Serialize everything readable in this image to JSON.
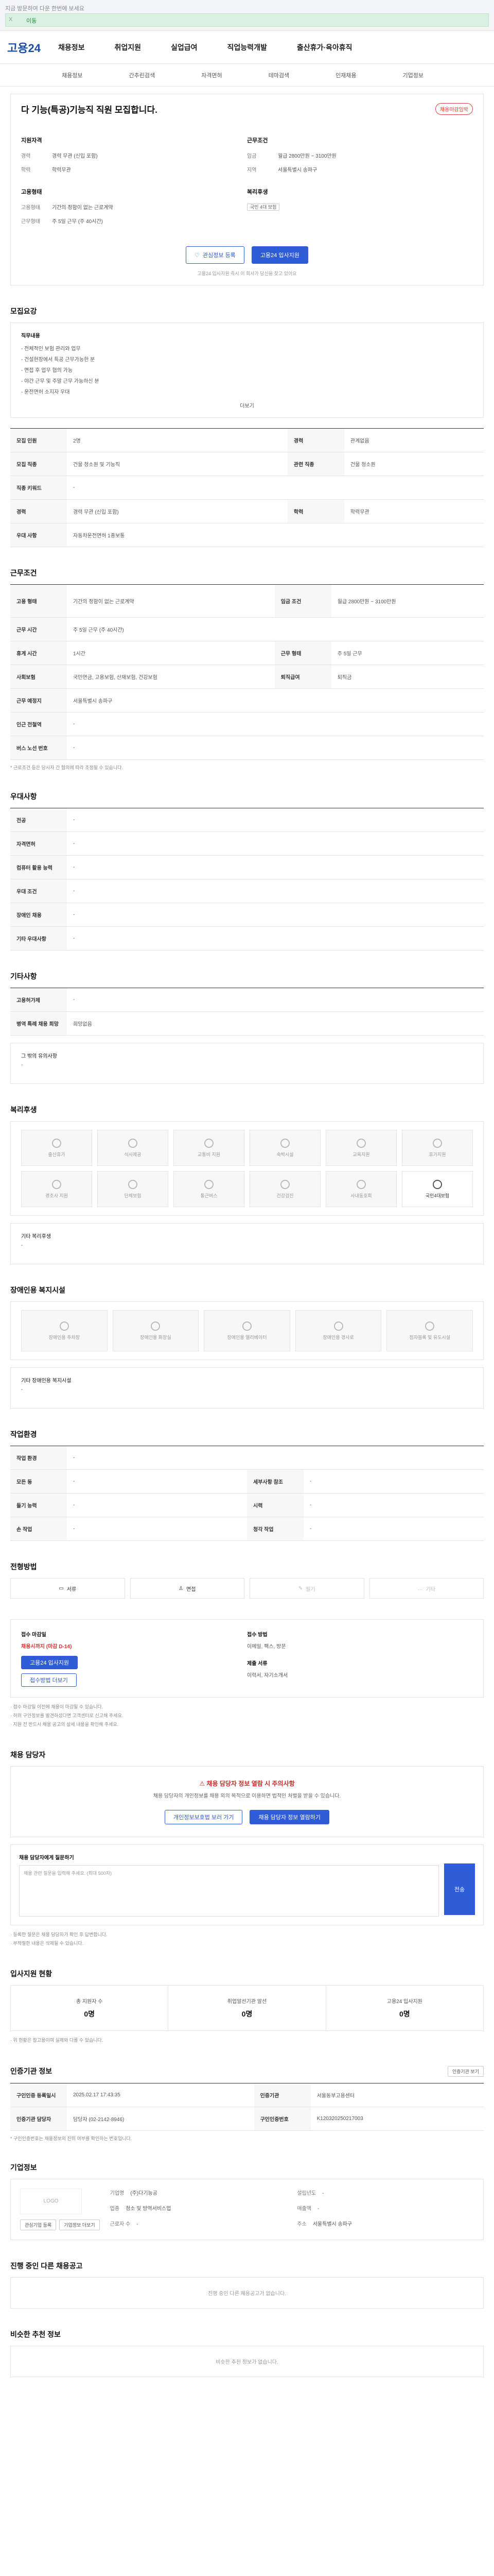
{
  "topbar": {
    "ad_text": "지금 방문하여 다운 한번에 보세요",
    "close": "X",
    "go": "이동"
  },
  "gnb": {
    "logo": "고용24",
    "items": [
      "채용정보",
      "취업지원",
      "실업급여",
      "직업능력개발",
      "출산휴가·육아휴직"
    ]
  },
  "subnav": [
    "채용정보",
    "간추린검색",
    "자격면허",
    "테마검색",
    "인재채용",
    "기업정보"
  ],
  "title": {
    "text": "다 기능(특공)기능직 직원 모집합니다.",
    "badge": "채용마감임박"
  },
  "summary": {
    "left_label": "지원자격",
    "left": [
      {
        "k": "경력",
        "v": "경력 무관 (신입 포함)"
      },
      {
        "k": "학력",
        "v": "학력무관"
      }
    ],
    "left_label2": "고용형태",
    "left2": [
      {
        "k": "고용형태",
        "v": "기간의 정함이 없는 근로계약"
      },
      {
        "k": "근무형태",
        "v": "주 5일 근무 (주 40시간)"
      }
    ],
    "right_label": "근무조건",
    "right": [
      {
        "k": "임금",
        "v": "월급 2800만원 ~ 3100만원"
      },
      {
        "k": "지역",
        "v": "서울특별시 송파구"
      }
    ],
    "right_label2": "복리후생",
    "right_tag": "국민 4대 보험"
  },
  "buttons": {
    "scrap": "관심정보 등록",
    "apply": "고용24 입사지원"
  },
  "note": "고용24 입사지원 즉시 이 회사가 당신을 찾고 있어요",
  "recruit": {
    "title": "모집요강",
    "subtitle": "직무내용",
    "lines": [
      "- 전체적인 보험 관리와 업무",
      "- 건설현장에서 특공 근무가능한 분",
      "- 면접 후 업무 협의 가능",
      "- 야간 근무 및 주말 근무 가능하신 분",
      "- 운전면허 소지자 우대"
    ],
    "more": "더보기"
  },
  "info_rows": [
    {
      "k1": "모집 인원",
      "v1": "2명",
      "k2": "경력",
      "v2": "관계없음"
    },
    {
      "k1": "모집 직종",
      "v1": "건물 청소원 및 기능직",
      "k2": "관련 직종",
      "v2": "건물 청소원"
    },
    {
      "k1": "직종 키워드",
      "v1": "-",
      "k2": "",
      "v2": ""
    },
    {
      "k1": "경력",
      "v1": "경력 무관 (신입 포함)",
      "k2": "학력",
      "v2": "학력무관"
    },
    {
      "k1": "우대 사항",
      "v1": "자동차운전면허 1종보통",
      "k2": "",
      "v2": ""
    }
  ],
  "workcond": {
    "title": "근무조건",
    "rows": [
      {
        "k1": "고용 형태",
        "v1": "기간의 정함이 없는 근로계약",
        "k2": "임금 조건",
        "v2": "월급 2800만원 ~ 3100만원"
      },
      {
        "k1": "근무 시간",
        "v1": "주 5일 근무 (주 40시간)",
        "k2": "",
        "v2": ""
      },
      {
        "k1": "휴게 시간",
        "v1": "1시간",
        "k2": "근무 형태",
        "v2": "주 5일 근무"
      },
      {
        "k1": "사회보험",
        "v1": "국민연금, 고용보험, 산재보험, 건강보험",
        "k2": "퇴직급여",
        "v2": "퇴직금"
      },
      {
        "k1": "근무 예정지",
        "v1": "서울특별시 송파구",
        "k2": "",
        "v2": ""
      },
      {
        "k1": "인근 전철역",
        "v1": "-",
        "k2": "",
        "v2": ""
      },
      {
        "k1": "버스 노선 번호",
        "v1": "-",
        "k2": "",
        "v2": ""
      }
    ],
    "note": "* 근로조건 등은 당사자 간 협의에 따라 조정될 수 있습니다."
  },
  "etc": {
    "title": "우대사항",
    "rows": [
      {
        "k": "전공",
        "v": "-"
      },
      {
        "k": "자격면허",
        "v": "-"
      },
      {
        "k": "컴퓨터 활용 능력",
        "v": "-"
      },
      {
        "k": "우대 조건",
        "v": "-"
      },
      {
        "k": "장애인 채용",
        "v": "-"
      },
      {
        "k": "기타 우대사항",
        "v": "-"
      }
    ]
  },
  "other": {
    "title": "기타사항",
    "rows": [
      {
        "k": "고용허가제",
        "v": "-"
      },
      {
        "k": "병역 특례 채용 희망",
        "v": "희망없음"
      }
    ],
    "extra_label": "그 밖의 유의사항",
    "extra_value": "-"
  },
  "welfare": {
    "title": "복리후생",
    "items": [
      "출산휴가",
      "식사제공",
      "교통비 지원",
      "숙박시설",
      "교육지원",
      "휴가지원",
      "경조사 지원",
      "단체보험",
      "통근버스",
      "건강검진",
      "사내동호회",
      "국민4대보험"
    ],
    "active": "국민4대보험",
    "note_label": "기타 복리후생",
    "note_value": "-"
  },
  "disability": {
    "title": "장애인용 복지시설",
    "items": [
      "장애인용 주차장",
      "장애인용 화장실",
      "장애인용 엘리베이터",
      "장애인용 경사로",
      "점자블록 및 유도시설"
    ],
    "note_label": "기타 장애인용 복지시설",
    "note_value": "-"
  },
  "workenv": {
    "title": "작업환경",
    "rows": [
      {
        "k1": "작업 환경",
        "v1": "-",
        "k2": "",
        "v2": ""
      },
      {
        "k1": "모든 동",
        "v1": "-",
        "k2": "세부사항 참조",
        "v2": "-"
      },
      {
        "k1": "들기 능력",
        "v1": "-",
        "k2": "시력",
        "v2": "-"
      },
      {
        "k1": "손 작업",
        "v1": "-",
        "k2": "청각 작업",
        "v2": "-"
      }
    ]
  },
  "process": {
    "title": "전형방법",
    "steps": [
      "서류",
      "면접",
      "필기",
      "기타"
    ]
  },
  "apply": {
    "c1_title": "접수 마감일",
    "c1_value": "채용시까지 (마감 D-14)",
    "c1_btn": "고용24 입사지원",
    "c1_btn2": "접수방법 더보기",
    "c2_title": "접수 방법",
    "c2_value": "이메일, 팩스, 방문",
    "c2_title2": "제출 서류",
    "c2_value2": "이력서, 자기소개서",
    "bullets": [
      "· 접수 마감일 이전에 채용이 마감될 수 있습니다.",
      "· 허위 구인정보를 발견하셨다면 고객센터로 신고해 주세요.",
      "· 지원 전 반드시 채용 공고의 상세 내용을 확인해 주세요."
    ]
  },
  "manager": {
    "title": "채용 담당자",
    "warn": "채용 담당자 정보 열람 시 주의사항",
    "desc": "채용 담당자의 개인정보를 채용 외의 목적으로 이용하면 법적인 처벌을 받을 수 있습니다.",
    "btn1": "개인정보보호법 보러 가기",
    "btn2": "채용 담당자 정보 열람하기"
  },
  "inquiry": {
    "title": "채용 담당자에게 질문하기",
    "placeholder": "채용 관련 질문을 입력해 주세요. (최대 500자)",
    "submit": "전송",
    "bullets": [
      "· 등록한 질문은 채용 담당자가 확인 후 답변합니다.",
      "· 부적절한 내용은 삭제될 수 있습니다."
    ]
  },
  "stats": {
    "title": "입사지원 현황",
    "items": [
      {
        "label": "총 지원자 수",
        "value": "0명"
      },
      {
        "label": "취업알선기관 알선",
        "value": "0명"
      },
      {
        "label": "고용24 입사지원",
        "value": "0명"
      }
    ],
    "note": "· 위 현황은 참고용이며 실제와 다를 수 있습니다."
  },
  "agency": {
    "title": "인증기관 정보",
    "btn": "인증기관 보기",
    "rows": [
      {
        "k1": "구인인증 등록일시",
        "v1": "2025.02.17 17:43:35",
        "k2": "인증기관",
        "v2": "서울동부고용센터"
      },
      {
        "k1": "인증기관 담당자",
        "v1": "담당자 (02-2142-8946)",
        "k2": "구인인증번호",
        "v2": "K120320250217003"
      }
    ],
    "note": "* 구인인증번호는 채용정보의 진위 여부를 확인하는 번호입니다."
  },
  "corp": {
    "title": "기업정보",
    "logo": "LOGO",
    "items": [
      {
        "k": "기업명",
        "v": "(주)다기능공"
      },
      {
        "k": "설립년도",
        "v": "-"
      },
      {
        "k": "업종",
        "v": "청소 및 방역서비스업"
      },
      {
        "k": "매출액",
        "v": "-"
      },
      {
        "k": "근로자 수",
        "v": "-"
      },
      {
        "k": "주소",
        "v": "서울특별시 송파구"
      }
    ],
    "btn1": "관심기업 등록",
    "btn2": "기업정보 더보기"
  },
  "others": {
    "title": "진행 중인 다른 채용공고",
    "empty": "진행 중인 다른 채용공고가 없습니다."
  },
  "similar": {
    "title": "비슷한 추천 정보",
    "empty": "비슷한 추천 정보가 없습니다."
  }
}
